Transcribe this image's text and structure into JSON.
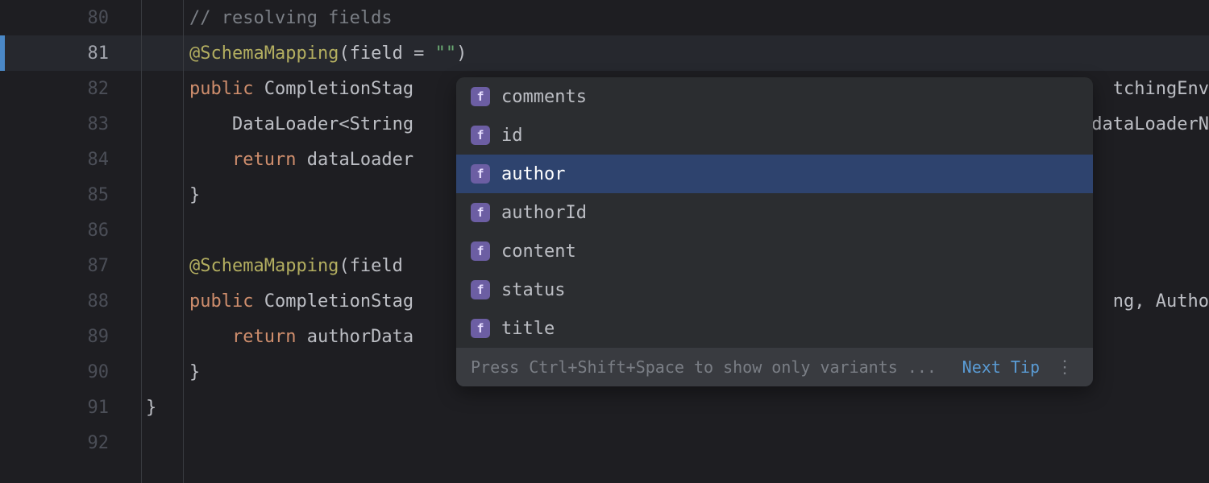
{
  "gutter": {
    "lines": [
      {
        "num": "80",
        "current": false,
        "marker": false,
        "icon": null,
        "icon2": null
      },
      {
        "num": "81",
        "current": true,
        "marker": true,
        "icon": "graphql",
        "icon2": null
      },
      {
        "num": "82",
        "current": false,
        "marker": false,
        "icon": "at",
        "icon2": "rename"
      },
      {
        "num": "83",
        "current": false,
        "marker": false,
        "icon": null,
        "icon2": null
      },
      {
        "num": "84",
        "current": false,
        "marker": false,
        "icon": null,
        "icon2": null
      },
      {
        "num": "85",
        "current": false,
        "marker": false,
        "icon": null,
        "icon2": null
      },
      {
        "num": "86",
        "current": false,
        "marker": false,
        "icon": null,
        "icon2": null
      },
      {
        "num": "87",
        "current": false,
        "marker": false,
        "icon": "graphql",
        "icon2": null
      },
      {
        "num": "88",
        "current": false,
        "marker": false,
        "icon": "at-bold",
        "icon2": null
      },
      {
        "num": "89",
        "current": false,
        "marker": false,
        "icon": null,
        "icon2": null
      },
      {
        "num": "90",
        "current": false,
        "marker": false,
        "icon": null,
        "icon2": null
      },
      {
        "num": "91",
        "current": false,
        "marker": false,
        "icon": null,
        "icon2": null
      },
      {
        "num": "92",
        "current": false,
        "marker": false,
        "icon": null,
        "icon2": null
      }
    ]
  },
  "code": {
    "l80": "// resolving fields",
    "l81_pre": "@SchemaMapping",
    "l81_paren": "(",
    "l81_field": "field = ",
    "l81_str": "\"\"",
    "l81_close": ")",
    "l82_kw": "public ",
    "l82_type": "CompletionStag",
    "l82_tail": "tchingEnv",
    "l83_pre": "    DataLoader<String",
    "l83_tail": "dataLoaderN",
    "l84_kw": "    return ",
    "l84_rest": "dataLoader",
    "l85": "}",
    "l87_pre": "@SchemaMapping",
    "l87_paren": "(",
    "l87_field": "field ",
    "l88_kw": "public ",
    "l88_type": "CompletionStag",
    "l88_tail": "ng, Autho",
    "l89_kw": "    return ",
    "l89_rest": "authorData",
    "l90": "}",
    "l91": "}"
  },
  "completion": {
    "items": [
      {
        "label": "comments",
        "selected": false
      },
      {
        "label": "id",
        "selected": false
      },
      {
        "label": "author",
        "selected": true
      },
      {
        "label": "authorId",
        "selected": false
      },
      {
        "label": "content",
        "selected": false
      },
      {
        "label": "status",
        "selected": false
      },
      {
        "label": "title",
        "selected": false
      }
    ],
    "field_glyph": "f",
    "hint": "Press Ctrl+Shift+Space to show only variants ...",
    "next_tip": "Next Tip",
    "menu_glyph": "⋮"
  }
}
